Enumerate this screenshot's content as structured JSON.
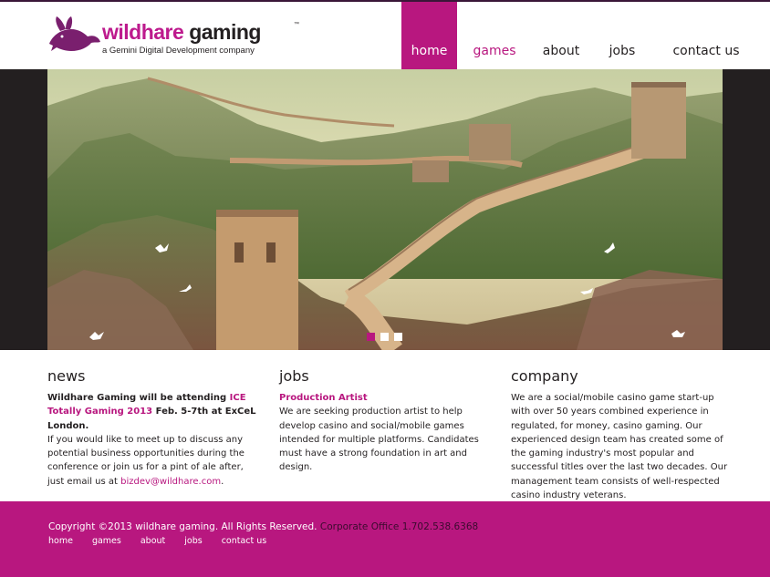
{
  "brand": {
    "name_part1": "wildhare",
    "name_part2": " gaming",
    "trademark": "™",
    "tagline": "a Gemini Digital Development company"
  },
  "nav": {
    "items": [
      "home",
      "games",
      "about",
      "jobs",
      "contact us"
    ],
    "active": "home",
    "underlined": "games"
  },
  "slider": {
    "current_slide": 1,
    "slide_count": 3
  },
  "news": {
    "heading": "news",
    "bold_1": "Wildhare Gaming will be attending ",
    "event_link": "ICE Totally Gaming 2013",
    "bold_2": " Feb. 5-7th at ExCeL London.",
    "body": "If you would like to meet up to discuss any potential business opportunities during the conference or join us for a pint of ale after, just email us at ",
    "email": "bizdev@wildhare.com",
    "end": "."
  },
  "jobs": {
    "heading": "jobs",
    "position": "Production Artist",
    "body": "We are seeking production artist to help develop casino and social/mobile games intended for multiple platforms. Candidates must have a strong foundation in art and design."
  },
  "company": {
    "heading": "company",
    "body": "We are a social/mobile casino game start-up with over 50 years combined experience in regulated, for money, casino gaming. Our experienced design team has created some of the gaming industry's most popular and successful titles over the last two decades. Our management team consists of well-respected casino industry veterans."
  },
  "footer": {
    "copyright": "Copyright ©2013 wildhare gaming. All Rights Reserved.",
    "office": "Corporate Office 1.702.538.6368",
    "links": [
      "home",
      "games",
      "about",
      "jobs",
      "contact us"
    ]
  },
  "colors": {
    "accent": "#b8177f",
    "dark": "#231f20",
    "background": "#ffffff"
  }
}
